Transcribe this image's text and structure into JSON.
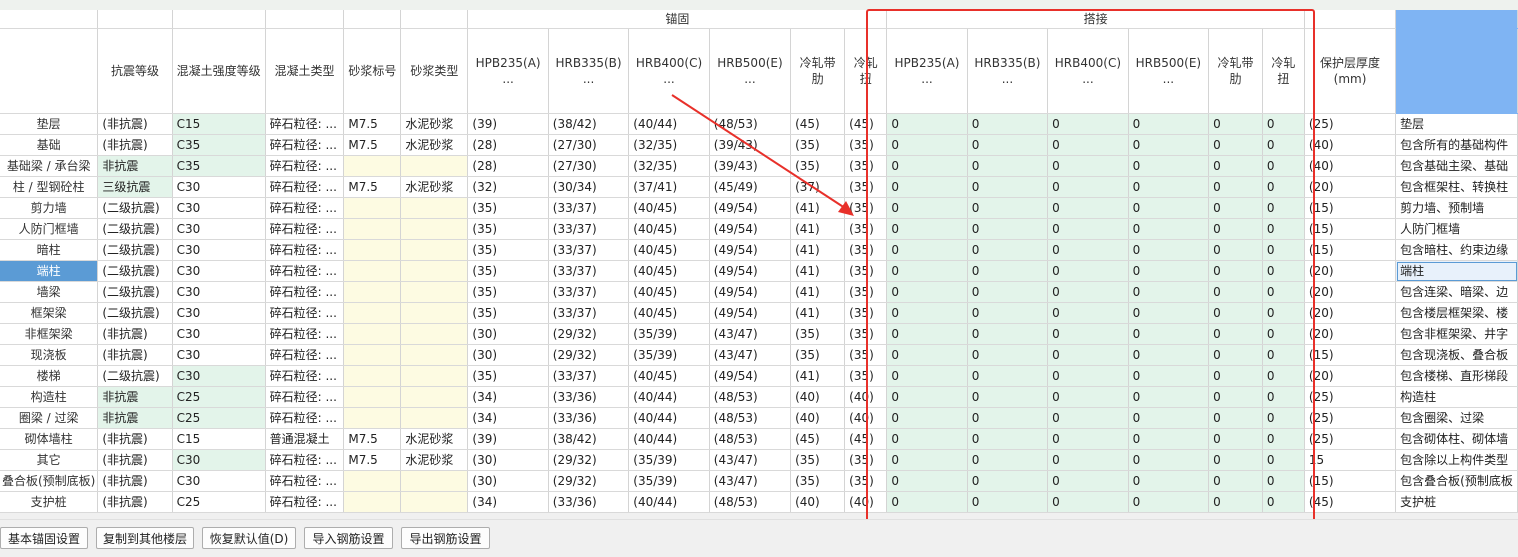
{
  "headers": {
    "group_anchor": "锚固",
    "group_lap": "搭接",
    "col_seismic": "抗震等级",
    "col_concrete_grade": "混凝土强度等级",
    "col_concrete_type": "混凝土类型",
    "col_mortar_grade": "砂浆标号",
    "col_mortar_type": "砂浆类型",
    "anchor_cols": [
      "HPB235(A)\n...",
      "HRB335(B)\n...",
      "HRB400(C)\n...",
      "HRB500(E)\n...",
      "冷轧带肋",
      "冷轧扭"
    ],
    "lap_cols": [
      "HPB235(A)\n...",
      "HRB335(B)\n...",
      "HRB400(C)\n...",
      "HRB500(E)\n...",
      "冷轧带肋",
      "冷轧扭"
    ],
    "col_cover": "保护层厚度(mm)"
  },
  "rows": [
    {
      "name": "垫层",
      "seismic": "(非抗震)",
      "grade": "C15",
      "ctype": "碎石粒径: ...",
      "mgrade": "M7.5",
      "mtype": "水泥砂浆",
      "anchor": [
        "(39)",
        "(38/42)",
        "(40/44)",
        "(48/53)",
        "(45)",
        "(45)"
      ],
      "lap": [
        "0",
        "0",
        "0",
        "0",
        "0",
        "0"
      ],
      "cover": "(25)",
      "note": "垫层"
    },
    {
      "name": "基础",
      "seismic": "(非抗震)",
      "grade": "C35",
      "ctype": "碎石粒径: ...",
      "mgrade": "M7.5",
      "mtype": "水泥砂浆",
      "anchor": [
        "(28)",
        "(27/30)",
        "(32/35)",
        "(39/43)",
        "(35)",
        "(35)"
      ],
      "lap": [
        "0",
        "0",
        "0",
        "0",
        "0",
        "0"
      ],
      "cover": "(40)",
      "note": "包含所有的基础构件"
    },
    {
      "name": "基础梁 / 承台梁",
      "seismic": "非抗震",
      "grade": "C35",
      "ctype": "碎石粒径: ...",
      "mgrade": "",
      "mtype": "",
      "anchor": [
        "(28)",
        "(27/30)",
        "(32/35)",
        "(39/43)",
        "(35)",
        "(35)"
      ],
      "lap": [
        "0",
        "0",
        "0",
        "0",
        "0",
        "0"
      ],
      "cover": "(40)",
      "note": "包含基础主梁、基础"
    },
    {
      "name": "柱 / 型钢砼柱",
      "seismic": "三级抗震",
      "grade": "C30",
      "ctype": "碎石粒径: ...",
      "mgrade": "M7.5",
      "mtype": "水泥砂浆",
      "anchor": [
        "(32)",
        "(30/34)",
        "(37/41)",
        "(45/49)",
        "(37)",
        "(35)"
      ],
      "lap": [
        "0",
        "0",
        "0",
        "0",
        "0",
        "0"
      ],
      "cover": "(20)",
      "note": "包含框架柱、转换柱"
    },
    {
      "name": "剪力墙",
      "seismic": "(二级抗震)",
      "grade": "C30",
      "ctype": "碎石粒径: ...",
      "mgrade": "",
      "mtype": "",
      "anchor": [
        "(35)",
        "(33/37)",
        "(40/45)",
        "(49/54)",
        "(41)",
        "(35)"
      ],
      "lap": [
        "0",
        "0",
        "0",
        "0",
        "0",
        "0"
      ],
      "cover": "(15)",
      "note": "剪力墙、预制墙"
    },
    {
      "name": "人防门框墙",
      "seismic": "(二级抗震)",
      "grade": "C30",
      "ctype": "碎石粒径: ...",
      "mgrade": "",
      "mtype": "",
      "anchor": [
        "(35)",
        "(33/37)",
        "(40/45)",
        "(49/54)",
        "(41)",
        "(35)"
      ],
      "lap": [
        "0",
        "0",
        "0",
        "0",
        "0",
        "0"
      ],
      "cover": "(15)",
      "note": "人防门框墙"
    },
    {
      "name": "暗柱",
      "seismic": "(二级抗震)",
      "grade": "C30",
      "ctype": "碎石粒径: ...",
      "mgrade": "",
      "mtype": "",
      "anchor": [
        "(35)",
        "(33/37)",
        "(40/45)",
        "(49/54)",
        "(41)",
        "(35)"
      ],
      "lap": [
        "0",
        "0",
        "0",
        "0",
        "0",
        "0"
      ],
      "cover": "(15)",
      "note": "包含暗柱、约束边缘"
    },
    {
      "name": "端柱",
      "seismic": "(二级抗震)",
      "grade": "C30",
      "ctype": "碎石粒径: ...",
      "mgrade": "",
      "mtype": "",
      "anchor": [
        "(35)",
        "(33/37)",
        "(40/45)",
        "(49/54)",
        "(41)",
        "(35)"
      ],
      "lap": [
        "0",
        "0",
        "0",
        "0",
        "0",
        "0"
      ],
      "cover": "(20)",
      "note": "端柱"
    },
    {
      "name": "墙梁",
      "seismic": "(二级抗震)",
      "grade": "C30",
      "ctype": "碎石粒径: ...",
      "mgrade": "",
      "mtype": "",
      "anchor": [
        "(35)",
        "(33/37)",
        "(40/45)",
        "(49/54)",
        "(41)",
        "(35)"
      ],
      "lap": [
        "0",
        "0",
        "0",
        "0",
        "0",
        "0"
      ],
      "cover": "(20)",
      "note": "包含连梁、暗梁、边"
    },
    {
      "name": "框架梁",
      "seismic": "(二级抗震)",
      "grade": "C30",
      "ctype": "碎石粒径: ...",
      "mgrade": "",
      "mtype": "",
      "anchor": [
        "(35)",
        "(33/37)",
        "(40/45)",
        "(49/54)",
        "(41)",
        "(35)"
      ],
      "lap": [
        "0",
        "0",
        "0",
        "0",
        "0",
        "0"
      ],
      "cover": "(20)",
      "note": "包含楼层框架梁、楼"
    },
    {
      "name": "非框架梁",
      "seismic": "(非抗震)",
      "grade": "C30",
      "ctype": "碎石粒径: ...",
      "mgrade": "",
      "mtype": "",
      "anchor": [
        "(30)",
        "(29/32)",
        "(35/39)",
        "(43/47)",
        "(35)",
        "(35)"
      ],
      "lap": [
        "0",
        "0",
        "0",
        "0",
        "0",
        "0"
      ],
      "cover": "(20)",
      "note": "包含非框架梁、井字"
    },
    {
      "name": "现浇板",
      "seismic": "(非抗震)",
      "grade": "C30",
      "ctype": "碎石粒径: ...",
      "mgrade": "",
      "mtype": "",
      "anchor": [
        "(30)",
        "(29/32)",
        "(35/39)",
        "(43/47)",
        "(35)",
        "(35)"
      ],
      "lap": [
        "0",
        "0",
        "0",
        "0",
        "0",
        "0"
      ],
      "cover": "(15)",
      "note": "包含现浇板、叠合板"
    },
    {
      "name": "楼梯",
      "seismic": "(二级抗震)",
      "grade": "C30",
      "ctype": "碎石粒径: ...",
      "mgrade": "",
      "mtype": "",
      "anchor": [
        "(35)",
        "(33/37)",
        "(40/45)",
        "(49/54)",
        "(41)",
        "(35)"
      ],
      "lap": [
        "0",
        "0",
        "0",
        "0",
        "0",
        "0"
      ],
      "cover": "(20)",
      "note": "包含楼梯、直形梯段"
    },
    {
      "name": "构造柱",
      "seismic": "非抗震",
      "grade": "C25",
      "ctype": "碎石粒径: ...",
      "mgrade": "",
      "mtype": "",
      "anchor": [
        "(34)",
        "(33/36)",
        "(40/44)",
        "(48/53)",
        "(40)",
        "(40)"
      ],
      "lap": [
        "0",
        "0",
        "0",
        "0",
        "0",
        "0"
      ],
      "cover": "(25)",
      "note": "构造柱"
    },
    {
      "name": "圈梁 / 过梁",
      "seismic": "非抗震",
      "grade": "C25",
      "ctype": "碎石粒径: ...",
      "mgrade": "",
      "mtype": "",
      "anchor": [
        "(34)",
        "(33/36)",
        "(40/44)",
        "(48/53)",
        "(40)",
        "(40)"
      ],
      "lap": [
        "0",
        "0",
        "0",
        "0",
        "0",
        "0"
      ],
      "cover": "(25)",
      "note": "包含圈梁、过梁"
    },
    {
      "name": "砌体墙柱",
      "seismic": "(非抗震)",
      "grade": "C15",
      "ctype": "普通混凝土",
      "mgrade": "M7.5",
      "mtype": "水泥砂浆",
      "anchor": [
        "(39)",
        "(38/42)",
        "(40/44)",
        "(48/53)",
        "(45)",
        "(45)"
      ],
      "lap": [
        "0",
        "0",
        "0",
        "0",
        "0",
        "0"
      ],
      "cover": "(25)",
      "note": "包含砌体柱、砌体墙"
    },
    {
      "name": "其它",
      "seismic": "(非抗震)",
      "grade": "C30",
      "ctype": "碎石粒径: ...",
      "mgrade": "M7.5",
      "mtype": "水泥砂浆",
      "anchor": [
        "(30)",
        "(29/32)",
        "(35/39)",
        "(43/47)",
        "(35)",
        "(35)"
      ],
      "lap": [
        "0",
        "0",
        "0",
        "0",
        "0",
        "0"
      ],
      "cover": "15",
      "note": "包含除以上构件类型"
    },
    {
      "name": "叠合板(预制底板)",
      "seismic": "(非抗震)",
      "grade": "C30",
      "ctype": "碎石粒径: ...",
      "mgrade": "",
      "mtype": "",
      "anchor": [
        "(30)",
        "(29/32)",
        "(35/39)",
        "(43/47)",
        "(35)",
        "(35)"
      ],
      "lap": [
        "0",
        "0",
        "0",
        "0",
        "0",
        "0"
      ],
      "cover": "(15)",
      "note": "包含叠合板(预制底板"
    },
    {
      "name": "支护桩",
      "seismic": "(非抗震)",
      "grade": "C25",
      "ctype": "碎石粒径: ...",
      "mgrade": "",
      "mtype": "",
      "anchor": [
        "(34)",
        "(33/36)",
        "(40/44)",
        "(48/53)",
        "(40)",
        "(40)"
      ],
      "lap": [
        "0",
        "0",
        "0",
        "0",
        "0",
        "0"
      ],
      "cover": "(45)",
      "note": "支护桩"
    }
  ],
  "buttons": {
    "basic_anchor": "基本锚固设置",
    "copy_floor": "复制到其他楼层",
    "restore_default": "恢复默认值(D)",
    "import_rebar": "导入钢筋设置",
    "export_rebar": "导出钢筋设置"
  },
  "colors": {
    "highlight_box": "#e8302a",
    "green_cell": "#e3f4ea",
    "yellow_cell": "#fdfbe2",
    "selected": "#5b9bd5"
  }
}
